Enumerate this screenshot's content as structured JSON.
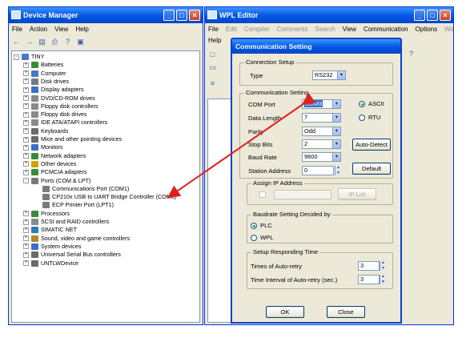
{
  "device_manager": {
    "title": "Device Manager",
    "menu": [
      "File",
      "Action",
      "View",
      "Help"
    ],
    "tree": {
      "root": "TINY",
      "items": [
        {
          "label": "Batteries",
          "color": "#3a8a3a"
        },
        {
          "label": "Computer",
          "color": "#4a78c8"
        },
        {
          "label": "Disk drives",
          "color": "#7a7a7a"
        },
        {
          "label": "Display adapters",
          "color": "#3b6fc7"
        },
        {
          "label": "DVD/CD-ROM drives",
          "color": "#8a8a8a"
        },
        {
          "label": "Floppy disk controllers",
          "color": "#8a8a8a"
        },
        {
          "label": "Floppy disk drives",
          "color": "#8a8a8a"
        },
        {
          "label": "IDE ATA/ATAPI controllers",
          "color": "#8a8a8a"
        },
        {
          "label": "Keyboards",
          "color": "#6a6a6a"
        },
        {
          "label": "Mice and other pointing devices",
          "color": "#6a6a6a"
        },
        {
          "label": "Monitors",
          "color": "#3b6fc7"
        },
        {
          "label": "Network adapters",
          "color": "#3a8a3a"
        },
        {
          "label": "Other devices",
          "color": "#d1a300"
        },
        {
          "label": "PCMCIA adapters",
          "color": "#3a8a3a"
        },
        {
          "label": "Ports (COM & LPT)",
          "color": "#7a7a7a"
        }
      ],
      "ports_children": [
        "Communications Port (COM1)",
        "CP210x USB to UART Bridge Controller (COM3)",
        "ECP Printer Port (LPT1)"
      ],
      "items_after": [
        {
          "label": "Processors",
          "color": "#3a8a3a"
        },
        {
          "label": "SCSI and RAID controllers",
          "color": "#8a8a8a"
        },
        {
          "label": "SIMATIC NET",
          "color": "#2c7bb6"
        },
        {
          "label": "Sound, video and game controllers",
          "color": "#b8862c"
        },
        {
          "label": "System devices",
          "color": "#3b6fc7"
        },
        {
          "label": "Universal Serial Bus controllers",
          "color": "#6a6a6a"
        },
        {
          "label": "UNTLWDevice",
          "color": "#6a6a6a"
        }
      ]
    }
  },
  "wpl_editor": {
    "title": "WPL Editor",
    "menu": [
      {
        "label": "File",
        "disabled": false
      },
      {
        "label": "Edit",
        "disabled": true
      },
      {
        "label": "Compiler",
        "disabled": true
      },
      {
        "label": "Comments",
        "disabled": true
      },
      {
        "label": "Search",
        "disabled": true
      },
      {
        "label": "View",
        "disabled": false
      },
      {
        "label": "Communication",
        "disabled": false
      },
      {
        "label": "Options",
        "disabled": false
      },
      {
        "label": "Window",
        "disabled": true
      }
    ],
    "help": "Help"
  },
  "dialog": {
    "title": "Communication Setting",
    "connection": {
      "group": "Connection Setup",
      "type_label": "Type",
      "type_value": "RS232"
    },
    "comm": {
      "group": "Communication Setting",
      "com_port_label": "COM Port",
      "com_port_value": "COM3",
      "data_length_label": "Data Length",
      "data_length_value": "7",
      "parity_label": "Parity",
      "parity_value": "Odd",
      "stop_bits_label": "Stop Bits",
      "stop_bits_value": "2",
      "baud_rate_label": "Baud Rate",
      "baud_rate_value": "9600",
      "station_label": "Station Address",
      "station_value": "0",
      "ascii": "ASCII",
      "rtu": "RTU",
      "auto_detect": "Auto-Detect",
      "default": "Default"
    },
    "assign_ip": {
      "group": "Assign IP Address",
      "ip_value": ". . .",
      "ip_list": "IP List"
    },
    "baudrate_decided": {
      "group": "Baudrate Setting Decided by",
      "plc": "PLC",
      "wpl": "WPL"
    },
    "setup_time": {
      "group": "Setup Responding Time",
      "retry_label": "Times of Auto-retry",
      "retry_value": "3",
      "interval_label": "Time Interval of Auto-retry (sec.)",
      "interval_value": "3"
    },
    "ok": "OK",
    "close": "Close"
  },
  "arrow_color": "#e02020"
}
